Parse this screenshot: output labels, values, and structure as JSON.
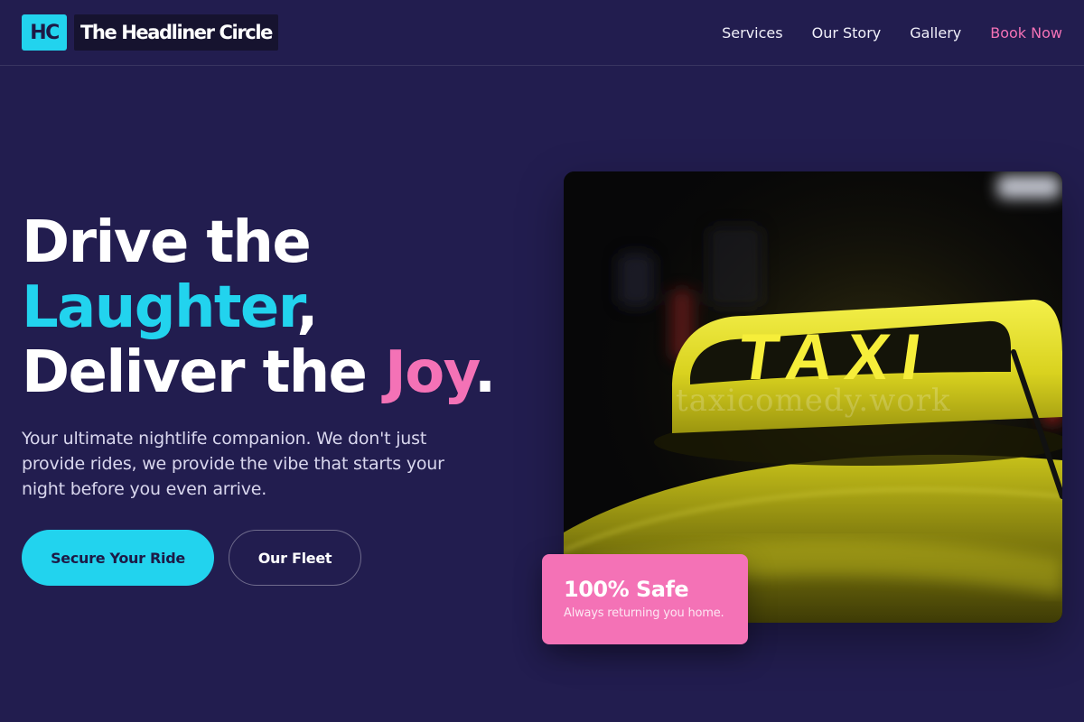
{
  "brand": {
    "badge": "HC",
    "name": "The Headliner Circle"
  },
  "nav": {
    "items": [
      "Services",
      "Our Story",
      "Gallery"
    ],
    "book": "Book Now"
  },
  "hero": {
    "line1": "Drive the",
    "line2_highlight": "Laughter",
    "line2_tail": ",",
    "line3_prefix": "Deliver the ",
    "line3_highlight": "Joy",
    "line3_tail": ".",
    "subtext": "Your ultimate nightlife companion. We don't just provide rides, we provide the vibe that starts your night before you even arrive.",
    "primary_cta": "Secure Your Ride",
    "secondary_cta": "Our Fleet"
  },
  "image": {
    "sign_text": "TAXI",
    "watermark": "taxicomedy.work"
  },
  "badge_card": {
    "title": "100% Safe",
    "subtitle": "Always returning you home."
  },
  "colors": {
    "background": "#221d4f",
    "accent_cyan": "#22d3ee",
    "accent_pink": "#f472b6"
  }
}
